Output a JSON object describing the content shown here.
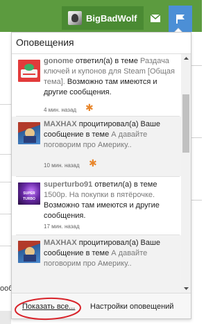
{
  "header": {
    "username": "BigBadWolf",
    "icons": {
      "avatar": "wolf-avatar",
      "mail": "envelope-icon",
      "alerts": "flag-icon"
    },
    "colors": {
      "bar": "#5c9b3f",
      "alerts_button": "#4c8fd6"
    }
  },
  "background": {
    "cut_text": "ообщ"
  },
  "notifications": {
    "title": "Оповещения",
    "items": [
      {
        "user": "gonome",
        "action": "ответил(а) в теме",
        "thread": "Раздача ключей и купонов для Steam [Общая тема].",
        "more": "Возможно там имеются и другие сообщения.",
        "time": "4 мин. назад",
        "unread": true,
        "avatar": "gonome-avatar"
      },
      {
        "user": "MAXHAX",
        "action": "процитировал(а) Ваше сообщение в теме",
        "thread": "А давайте поговорим про Америку..",
        "more": "",
        "time": "10 мин. назад",
        "unread": true,
        "avatar": "maxhax-avatar"
      },
      {
        "user": "superturbo91",
        "action": "ответил(а) в теме",
        "thread": "1500р. На покупки в пятёрочке.",
        "more": "Возможно там имеются и другие сообщения.",
        "time": "17 мин. назад",
        "unread": false,
        "avatar": "superturbo91-avatar",
        "avatar_text": "SUPER TURBO"
      },
      {
        "user": "MAXHAX",
        "action": "процитировал(а) Ваше сообщение в теме",
        "thread": "А давайте поговорим про Америку..",
        "more": "",
        "time": "",
        "unread": false,
        "avatar": "maxhax-avatar"
      }
    ],
    "footer": {
      "show_all": "Показать все...",
      "settings": "Настройки оповещений"
    },
    "unread_marker_color": "#e8862c"
  }
}
